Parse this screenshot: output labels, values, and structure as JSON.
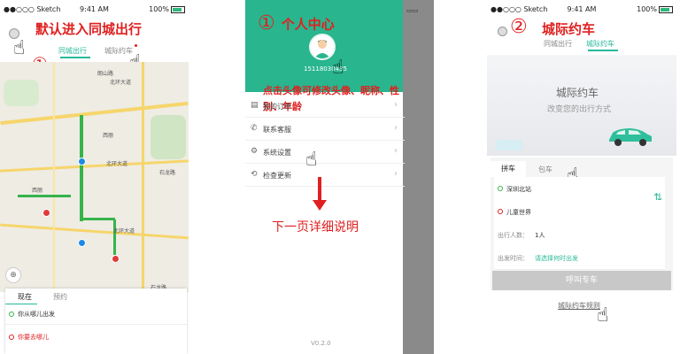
{
  "colors": {
    "accent": "#27b99a",
    "annotation": "#e02020",
    "header_green": "#29b58e"
  },
  "status_bar": {
    "carrier": "●●○○○ Sketch",
    "time": "9:41 AM",
    "battery": "100%"
  },
  "screen1": {
    "annotation_title": "默认进入同城出行",
    "marker_1": "①",
    "marker_2": "②",
    "tabs": [
      "同城出行",
      "城际约车"
    ],
    "map_labels": [
      "北环大道",
      "北环大道",
      "北环大道",
      "西丽",
      "西丽",
      "石龙路",
      "石龙路",
      "朗山路"
    ],
    "mode_tabs": [
      "现在",
      "预约"
    ],
    "from_placeholder": "你从哪儿出发",
    "to_placeholder": "你要去哪儿"
  },
  "screen2": {
    "annotation_title": "个人中心",
    "marker": "①",
    "phone_number": "15118030435",
    "annotation_avatar": "点击头像可修改头像、昵称、性别、年龄",
    "menu": [
      "我的订单",
      "联系客服",
      "系统设置",
      "检查更新"
    ],
    "annotation_next": "下一页详细说明",
    "version": "V0.2.0"
  },
  "screen3": {
    "marker": "②",
    "annotation_title": "城际约车",
    "tabs": [
      "同城出行",
      "城际约车"
    ],
    "hero_title": "城际约车",
    "hero_subtitle": "改变您的出行方式",
    "ride_tabs": [
      "拼车",
      "包车"
    ],
    "from_station": "深圳北站",
    "to_station": "儿童世界",
    "passengers_label": "出行人数：",
    "passengers_value": "1人",
    "time_label": "出发时间：",
    "time_value": "请选择何时出发",
    "call_button": "呼叫专车",
    "rules_link": "城际约车规则"
  }
}
